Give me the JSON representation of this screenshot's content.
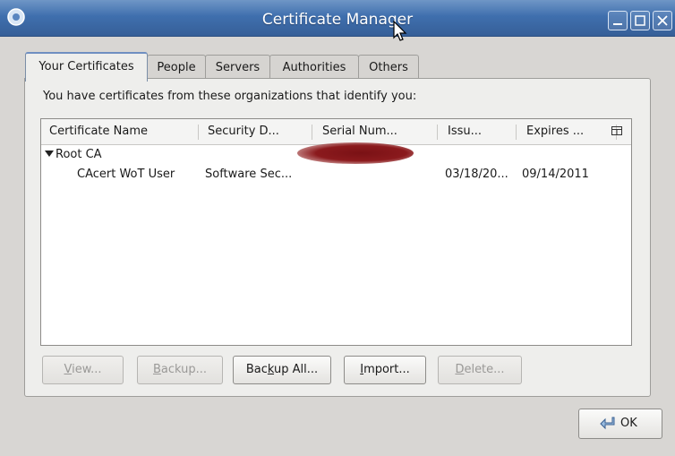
{
  "window": {
    "title": "Certificate Manager"
  },
  "tabs": [
    {
      "label": "Your Certificates",
      "active": true
    },
    {
      "label": "People",
      "active": false
    },
    {
      "label": "Servers",
      "active": false
    },
    {
      "label": "Authorities",
      "active": false
    },
    {
      "label": "Others",
      "active": false
    }
  ],
  "intro_text": "You have certificates from these organizations that identify you:",
  "columns": [
    "Certificate Name",
    "Security D...",
    "Serial Num...",
    "Issu...",
    "Expires ..."
  ],
  "tree": {
    "group": {
      "label": "Root CA",
      "expanded": true
    },
    "rows": [
      {
        "name": "CAcert WoT User",
        "security_device": "Software Sec...",
        "serial": "",
        "issued": "03/18/20...",
        "expires": "09/14/2011"
      }
    ]
  },
  "buttons": {
    "view": {
      "pre": "",
      "u": "V",
      "post": "iew...",
      "enabled": false
    },
    "backup": {
      "pre": "",
      "u": "B",
      "post": "ackup...",
      "enabled": false
    },
    "backup_all": {
      "pre": "Bac",
      "u": "k",
      "post": "up All...",
      "enabled": true
    },
    "import": {
      "pre": "",
      "u": "I",
      "post": "mport...",
      "enabled": true
    },
    "delete": {
      "pre": "",
      "u": "D",
      "post": "elete...",
      "enabled": false
    }
  },
  "ok": {
    "label": "OK"
  },
  "icons": {
    "app": "certificate-app-icon",
    "minimize": "minimize-icon",
    "maximize": "maximize-icon",
    "close": "close-icon",
    "column_picker": "column-picker-icon",
    "ok": "ok-arrow-icon"
  },
  "colors": {
    "titlebar": "#3f6fae",
    "redaction": "#8b1a1d"
  }
}
